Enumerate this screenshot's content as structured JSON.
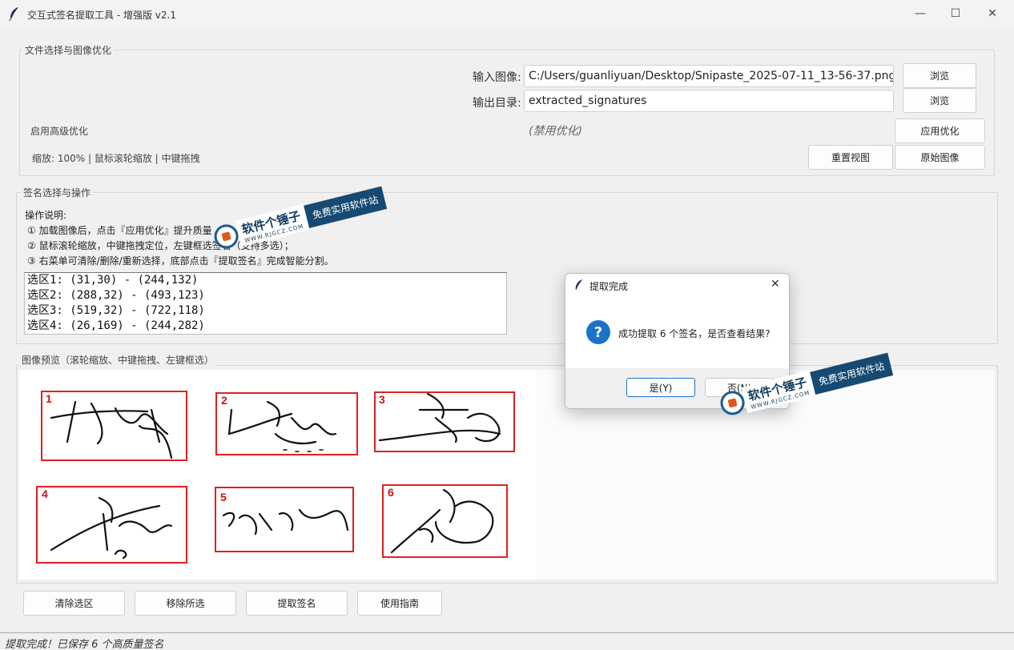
{
  "window": {
    "title": "交互式签名提取工具 - 增强版 v2.1",
    "minimize": "—",
    "maximize": "☐",
    "close": "✕"
  },
  "file_section": {
    "title": "文件选择与图像优化",
    "input_label": "输入图像:",
    "input_value": "C:/Users/guanliyuan/Desktop/Snipaste_2025-07-11_13-56-37.png",
    "browse1": "浏览",
    "output_label": "输出目录:",
    "output_value": "extracted_signatures",
    "browse2": "浏览",
    "advanced_label": "启用高级优化",
    "disabled_note": "(禁用优化)",
    "apply_button": "应用优化",
    "zoom_info": "缩放: 100% | 鼠标滚轮缩放 | 中键拖拽",
    "reset_view_button": "重置视图",
    "original_button": "原始图像"
  },
  "selection_section": {
    "title": "签名选择与操作",
    "instructions_title": "操作说明:",
    "line1": "① 加载图像后，点击『应用优化』提升质量",
    "line2": "② 鼠标滚轮缩放，中键拖拽定位，左键框选签名（支持多选）；",
    "line3": "③ 右菜单可清除/删除/重新选择，底部点击『提取签名』完成智能分割。",
    "regions": [
      "选区1: (31,30) - (244,132)",
      "选区2: (288,32) - (493,123)",
      "选区3: (519,32) - (722,118)",
      "选区4: (26,169) - (244,282)"
    ]
  },
  "preview_section": {
    "title": "图像预览（滚轮缩放、中键拖拽、左键框选）",
    "box_numbers": [
      "1",
      "2",
      "3",
      "4",
      "5",
      "6"
    ]
  },
  "bottom_buttons": {
    "clear": "清除选区",
    "remove": "移除所选",
    "extract": "提取签名",
    "guide": "使用指南"
  },
  "status": "提取完成！已保存 6 个高质量签名",
  "dialog": {
    "title": "提取完成",
    "message": "成功提取 6 个签名，是否查看结果?",
    "yes": "是(Y)",
    "no": "否(N)",
    "icon_glyph": "?"
  },
  "watermark": {
    "brand": "软件个锤子",
    "site": "WWW.RJGCZ.COM",
    "slogan": "免费实用软件站"
  },
  "colors": {
    "accent": "#1a73c8",
    "selection_box": "#e02020",
    "watermark_blue": "#174a72"
  }
}
